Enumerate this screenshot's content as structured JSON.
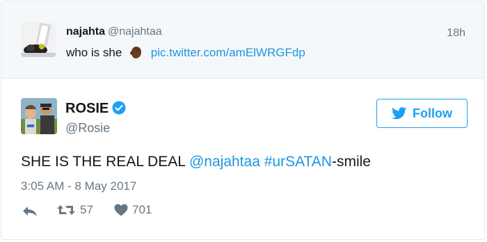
{
  "parent_tweet": {
    "display_name": "najahta",
    "handle": "@najahtaa",
    "time": "18h",
    "text": "who is she",
    "emoji": "dark-skin-hand-emoji",
    "link": "pic.twitter.com/amElWRGFdp"
  },
  "main_tweet": {
    "display_name": "ROSIE",
    "handle": "@Rosie",
    "verified": true,
    "follow_label": "Follow",
    "text_before": "SHE IS THE REAL DEAL ",
    "mention": "@najahtaa",
    "space": " ",
    "hashtag": "#urSATAN",
    "text_after": "-smile",
    "timestamp": "3:05 AM - 8 May 2017",
    "retweets": "57",
    "likes": "701"
  },
  "colors": {
    "accent": "#1da1f2",
    "link": "#1b95e0",
    "muted": "#657786",
    "parent_bg": "#f5f8fa",
    "border": "#e1e8ed"
  }
}
